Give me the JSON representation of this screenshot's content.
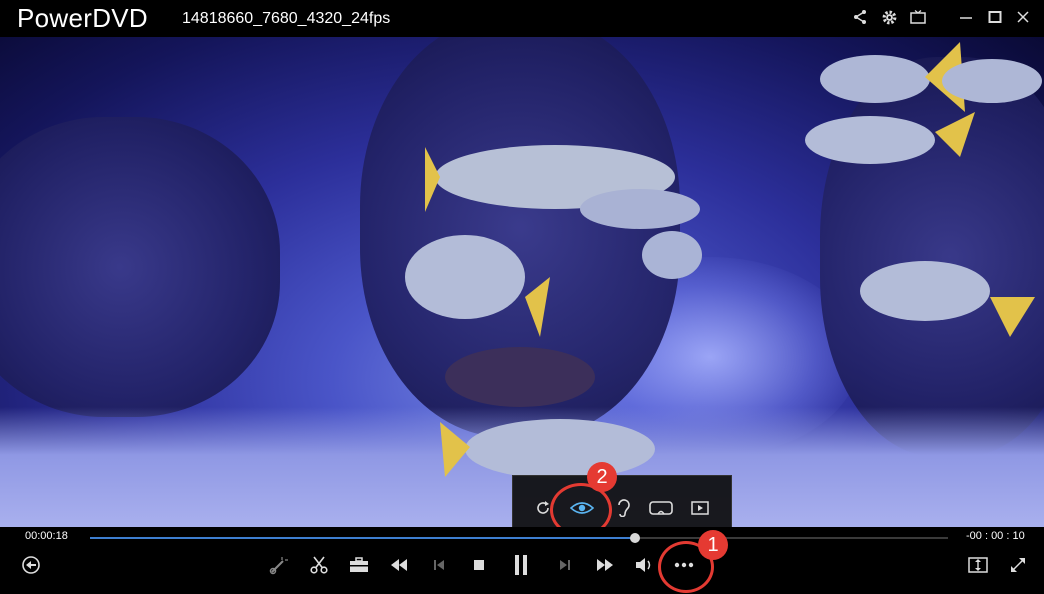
{
  "window": {
    "app_title": "PowerDVD",
    "file_title": "14818660_7680_4320_24fps"
  },
  "titlebar_icons": [
    "share-icon",
    "gear-icon",
    "tv-mode-icon",
    "minimize-icon",
    "maximize-icon",
    "close-icon"
  ],
  "popup_menu": {
    "items": [
      "repeat-icon",
      "eye-icon",
      "ear-icon",
      "vr-goggles-icon",
      "play-screen-icon"
    ]
  },
  "playback": {
    "elapsed": "00:00:18",
    "remaining": "-00 : 00 : 10",
    "progress": 0.635
  },
  "controls": {
    "items": [
      "back-icon",
      "cut-icon",
      "scissors-icon",
      "toolbox-icon",
      "rewind-icon",
      "previous-icon",
      "stop-icon",
      "pause-icon",
      "next-icon",
      "fast-forward-icon",
      "volume-icon",
      "more-icon",
      "fit-screen-icon",
      "fullscreen-icon"
    ]
  },
  "annotations": {
    "marker_1": "1",
    "marker_2": "2",
    "accent_color": "#e53a32"
  },
  "colors": {
    "progress_fill": "#3e7fd0",
    "active_icon": "#5ab4f0"
  }
}
